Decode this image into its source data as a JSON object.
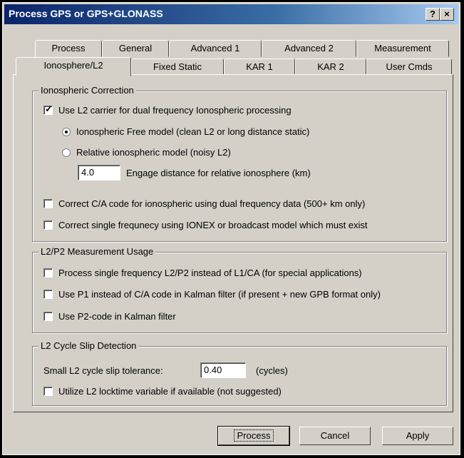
{
  "window": {
    "title": "Process GPS or GPS+GLONASS",
    "help": "?",
    "close": "×"
  },
  "tabs_row1": [
    "Process",
    "General",
    "Advanced 1",
    "Advanced 2",
    "Measurement"
  ],
  "tabs_row2": [
    "Ionosphere/L2",
    "Fixed Static",
    "KAR 1",
    "KAR 2",
    "User Cmds"
  ],
  "iono": {
    "title": "Ionospheric Correction",
    "use_l2": "Use L2 carrier for dual frequency Ionospheric processing",
    "free_model": "Ionospheric Free model (clean L2 or long distance static)",
    "relative_model": "Relative ionospheric model (noisy L2)",
    "engage_value": "4.0",
    "engage_label": "Engage distance for relative ionosphere (km)",
    "correct_ca": "Correct C/A code for ionospheric using dual frequency data (500+ km only)",
    "correct_single": "Correct single frequnecy using IONEX or broadcast model which must exist"
  },
  "l2p2": {
    "title": "L2/P2 Measurement Usage",
    "single_freq": "Process single frequency L2/P2 instead of L1/CA (for special applications)",
    "use_p1": "Use P1 instead of C/A code in Kalman filter (if present + new GPB format only)",
    "use_p2": "Use P2-code in Kalman filter"
  },
  "slip": {
    "title": "L2 Cycle Slip Detection",
    "tol_label": "Small L2 cycle slip tolerance:",
    "tol_value": "0.40",
    "tol_unit": "(cycles)",
    "locktime": "Utilize L2 locktime variable if available (not suggested)"
  },
  "buttons": {
    "process": "Process",
    "cancel": "Cancel",
    "apply": "Apply"
  }
}
